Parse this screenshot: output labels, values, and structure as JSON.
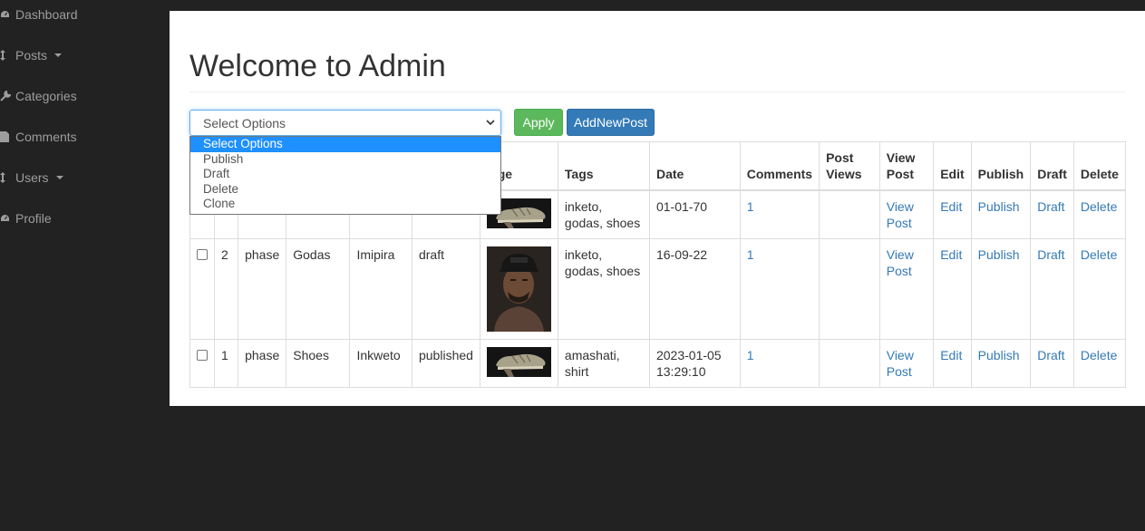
{
  "sidebar": {
    "items": [
      {
        "label": "Dashboard",
        "icon": "dashboard-icon"
      },
      {
        "label": "Posts",
        "icon": "arrows-vertical-icon",
        "has_caret": true
      },
      {
        "label": "Categories",
        "icon": "wrench-icon"
      },
      {
        "label": "Comments",
        "icon": "file-icon"
      },
      {
        "label": "Users",
        "icon": "arrows-vertical-icon",
        "has_caret": true
      },
      {
        "label": "Profile",
        "icon": "dashboard-icon"
      }
    ]
  },
  "main": {
    "title": "Welcome to Admin",
    "bulk_select": {
      "value": "Select Options",
      "options": [
        "Select Options",
        "Publish",
        "Draft",
        "Delete",
        "Clone"
      ]
    },
    "apply_label": "Apply",
    "add_new_label": "AddNewPost"
  },
  "table": {
    "headers": [
      "",
      "",
      "",
      "",
      "",
      "",
      "age",
      "Tags",
      "Date",
      "Comments",
      "Post Views",
      "View Post",
      "Edit",
      "Publish",
      "Draft",
      "Delete"
    ],
    "rows": [
      {
        "id": "",
        "author": "",
        "title": "",
        "category": "",
        "status": "",
        "image": "sneaker",
        "tags": "inketo, godas, shoes",
        "date": "01-01-70",
        "comments": "1",
        "views": "",
        "view": "View Post",
        "edit": "Edit",
        "publish": "Publish",
        "draft": "Draft",
        "delete": "Delete"
      },
      {
        "id": "2",
        "author": "phase",
        "title": "Godas",
        "category": "Imipira",
        "status": "draft",
        "image": "portrait",
        "tags": "inketo, godas, shoes",
        "date": "16-09-22",
        "comments": "1",
        "views": "",
        "view": "View Post",
        "edit": "Edit",
        "publish": "Publish",
        "draft": "Draft",
        "delete": "Delete"
      },
      {
        "id": "1",
        "author": "phase",
        "title": "Shoes",
        "category": "Inkweto",
        "status": "published",
        "image": "sneaker",
        "tags": "amashati, shirt",
        "date": "2023-01-05 13:29:10",
        "comments": "1",
        "views": "",
        "view": "View Post",
        "edit": "Edit",
        "publish": "Publish",
        "draft": "Draft",
        "delete": "Delete"
      }
    ]
  },
  "colors": {
    "background": "#222222",
    "panel": "#ffffff",
    "link": "#337ab7",
    "apply": "#5cb85c",
    "add_new": "#337ab7",
    "option_highlight": "#1e90ff"
  }
}
